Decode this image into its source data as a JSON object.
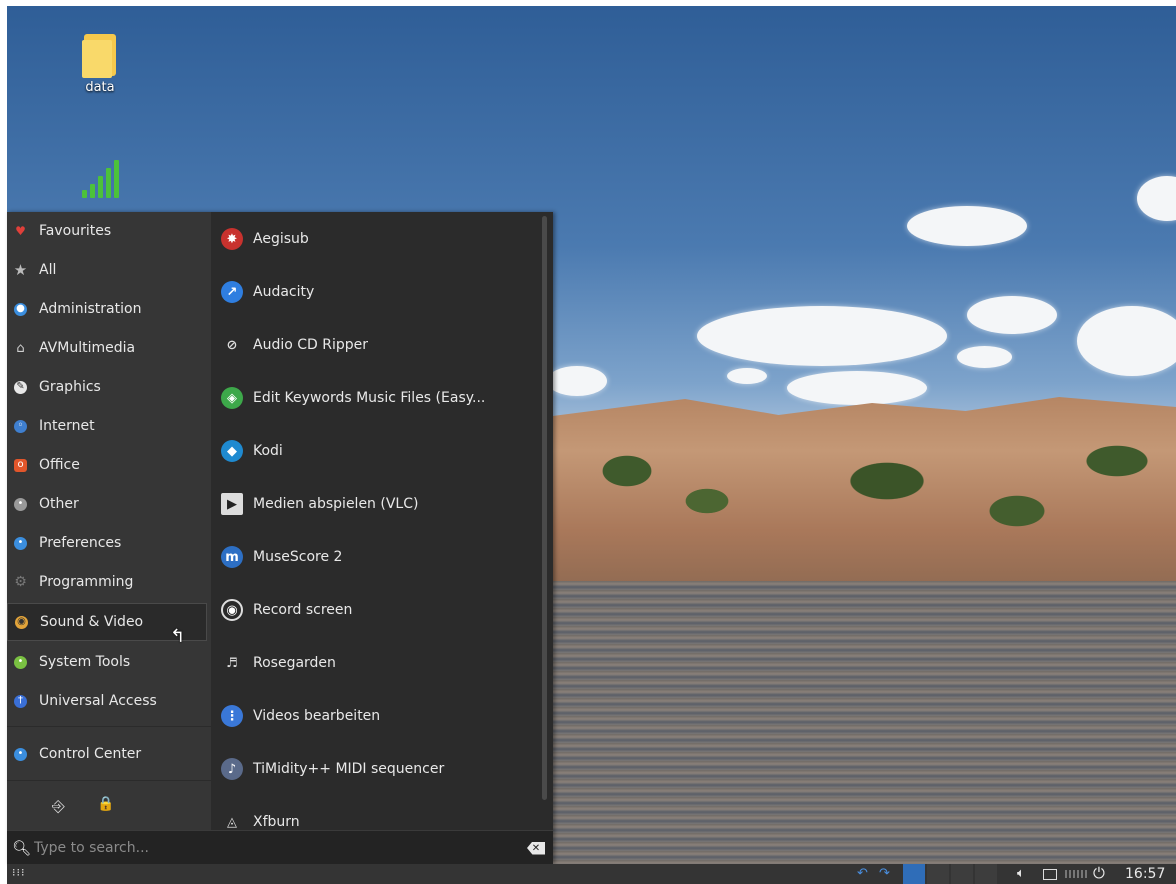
{
  "desktop": {
    "icons": [
      {
        "label": "data",
        "icon": "folder-icon"
      },
      {
        "label": "",
        "icon": "wifi-signal-icon"
      }
    ]
  },
  "menu": {
    "categories": [
      {
        "label": "Favourites",
        "icon": "heart-icon",
        "color": "#e0403a"
      },
      {
        "label": "All",
        "icon": "star-icon",
        "color": "#bbbbbb"
      },
      {
        "label": "Administration",
        "icon": "administration-icon",
        "color": "#3b8ede"
      },
      {
        "label": "AVMultimedia",
        "icon": "home-icon",
        "color": "#cfcfcf"
      },
      {
        "label": "Graphics",
        "icon": "graphics-icon",
        "color": "#e8e8e8"
      },
      {
        "label": "Internet",
        "icon": "internet-icon",
        "color": "#3f7fcf"
      },
      {
        "label": "Office",
        "icon": "office-icon",
        "color": "#e2562b"
      },
      {
        "label": "Other",
        "icon": "other-icon",
        "color": "#9a9a9a"
      },
      {
        "label": "Preferences",
        "icon": "preferences-icon",
        "color": "#3b8ede"
      },
      {
        "label": "Programming",
        "icon": "programming-icon",
        "color": "#777777"
      },
      {
        "label": "Sound & Video",
        "icon": "sound-video-icon",
        "color": "#e2a43a"
      },
      {
        "label": "System Tools",
        "icon": "system-tools-icon",
        "color": "#7ac142"
      },
      {
        "label": "Universal Access",
        "icon": "universal-access-icon",
        "color": "#3a6fd6"
      },
      {
        "label": "Control Center",
        "icon": "control-center-icon",
        "color": "#3b8ede"
      }
    ],
    "active_category": "Sound & Video",
    "bottom_actions": [
      {
        "name": "logout-icon",
        "glyph": "⎆"
      },
      {
        "name": "lock-icon",
        "glyph": "🔒"
      }
    ],
    "apps": [
      {
        "label": "Aegisub",
        "icon": "aegisub-icon",
        "color": "#c8322e",
        "glyph": "✸"
      },
      {
        "label": "Audacity",
        "icon": "audacity-icon",
        "color": "#2f7ee0",
        "glyph": "↗"
      },
      {
        "label": "Audio CD Ripper",
        "icon": "cd-ripper-icon",
        "color": "transparent",
        "glyph": "⊘"
      },
      {
        "label": "Edit Keywords Music Files (Easy...",
        "icon": "easytag-icon",
        "color": "#3da84a",
        "glyph": "◈"
      },
      {
        "label": "Kodi",
        "icon": "kodi-icon",
        "color": "#1f8ad0",
        "glyph": "◆"
      },
      {
        "label": "Medien abspielen (VLC)",
        "icon": "vlc-clapper-icon",
        "color": "#dddddd",
        "glyph": "▶"
      },
      {
        "label": "MuseScore 2",
        "icon": "musescore-icon",
        "color": "#2d6fc4",
        "glyph": "m"
      },
      {
        "label": "Record screen",
        "icon": "obs-icon",
        "color": "#2a2a2a",
        "glyph": "◉"
      },
      {
        "label": "Rosegarden",
        "icon": "music-note-icon",
        "color": "transparent",
        "glyph": "♬"
      },
      {
        "label": "Videos bearbeiten",
        "icon": "video-editor-icon",
        "color": "#3a78d8",
        "glyph": "⋮"
      },
      {
        "label": "TiMidity++ MIDI sequencer",
        "icon": "timidity-icon",
        "color": "#5a6a8a",
        "glyph": "♪"
      },
      {
        "label": "Xfburn",
        "icon": "xfburn-icon",
        "color": "transparent",
        "glyph": "◬"
      }
    ],
    "search": {
      "placeholder": "Type to search..."
    }
  },
  "panel": {
    "clock": "16:57"
  }
}
